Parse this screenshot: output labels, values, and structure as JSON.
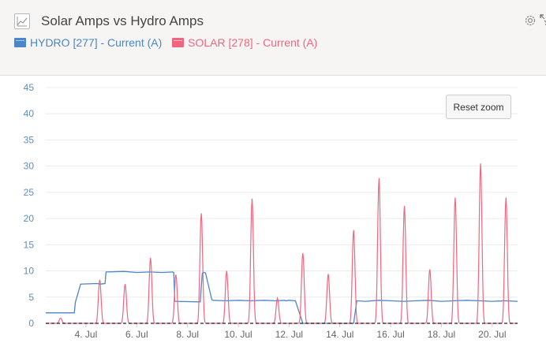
{
  "header": {
    "title": "Solar Amps vs Hydro Amps",
    "icon": "line-chart-icon",
    "settings_icon": "gear-icon",
    "fullscreen_icon": "expand-icon"
  },
  "reset_zoom_label": "Reset zoom",
  "colors": {
    "hydro": "#4a86c8",
    "solar": "#f0667e",
    "threshold": "#222222",
    "header_bg": "#f7f5f3"
  },
  "chart_data": {
    "type": "line",
    "ylim": [
      0,
      45
    ],
    "yticks": [
      0,
      5,
      10,
      15,
      20,
      25,
      30,
      35,
      40,
      45
    ],
    "xlim": [
      "2018-07-02T10:00",
      "2018-07-21T00:00"
    ],
    "xticks": [
      "4. Jul",
      "6. Jul",
      "8. Jul",
      "10. Jul",
      "12. Jul",
      "14. Jul",
      "16. Jul",
      "18. Jul",
      "20. Jul"
    ],
    "xtick_dates": [
      "2018-07-04",
      "2018-07-06",
      "2018-07-08",
      "2018-07-10",
      "2018-07-12",
      "2018-07-14",
      "2018-07-16",
      "2018-07-18",
      "2018-07-20"
    ],
    "grid": "horizontal",
    "legend": "top-left",
    "threshold_line": 0,
    "series": [
      {
        "name": "HYDRO [277] - Current (A)",
        "color": "#4a86c8",
        "x": [
          "2018-07-02T10:00",
          "2018-07-03T12:00",
          "2018-07-03T13:00",
          "2018-07-03T14:00",
          "2018-07-03T19:00",
          "2018-07-04T10:00",
          "2018-07-04T14:00",
          "2018-07-04T18:00",
          "2018-07-04T19:00",
          "2018-07-05T12:00",
          "2018-07-06T00:00",
          "2018-07-06T12:00",
          "2018-07-07T00:00",
          "2018-07-07T10:00",
          "2018-07-07T11:00",
          "2018-07-07T12:00",
          "2018-07-08T12:00",
          "2018-07-08T14:00",
          "2018-07-08T16:00",
          "2018-07-08T17:00",
          "2018-07-08T23:00",
          "2018-07-09T00:00",
          "2018-07-09T12:00",
          "2018-07-10T00:00",
          "2018-07-10T12:00",
          "2018-07-11T00:00",
          "2018-07-11T12:00",
          "2018-07-11T20:00",
          "2018-07-11T21:00",
          "2018-07-12T00:00",
          "2018-07-12T06:00",
          "2018-07-12T13:00",
          "2018-07-14T13:00",
          "2018-07-14T16:00",
          "2018-07-15T00:00",
          "2018-07-15T12:00",
          "2018-07-16T00:00",
          "2018-07-16T12:00",
          "2018-07-17T00:00",
          "2018-07-17T12:00",
          "2018-07-18T00:00",
          "2018-07-18T12:00",
          "2018-07-19T00:00",
          "2018-07-19T12:00",
          "2018-07-20T00:00",
          "2018-07-20T12:00",
          "2018-07-21T00:00"
        ],
        "values": [
          2,
          2,
          2,
          4,
          7.5,
          7.6,
          7.5,
          7.6,
          9.8,
          9.9,
          9.7,
          9.8,
          9.7,
          9.8,
          9.7,
          4.2,
          4.1,
          9.6,
          9.7,
          9.6,
          4.5,
          4.4,
          4.3,
          4.4,
          4.3,
          4.4,
          4.3,
          4.4,
          4.3,
          4.4,
          4.3,
          0,
          0,
          4.3,
          4.2,
          4.4,
          4.3,
          4.2,
          4.3,
          4.4,
          4.2,
          4.3,
          4.4,
          4.3,
          4.2,
          4.3,
          4.2
        ]
      },
      {
        "name": "SOLAR [278] - Current (A)",
        "color": "#f0667e",
        "peaks": [
          {
            "time": "2018-07-03T00:00",
            "value": 1.0
          },
          {
            "time": "2018-07-04T13:00",
            "value": 8.3
          },
          {
            "time": "2018-07-05T13:00",
            "value": 7.5
          },
          {
            "time": "2018-07-06T13:00",
            "value": 12.5
          },
          {
            "time": "2018-07-07T13:00",
            "value": 9.3
          },
          {
            "time": "2018-07-08T13:00",
            "value": 21.0
          },
          {
            "time": "2018-07-09T13:00",
            "value": 10.0
          },
          {
            "time": "2018-07-10T13:00",
            "value": 23.8
          },
          {
            "time": "2018-07-11T13:00",
            "value": 4.8
          },
          {
            "time": "2018-07-12T13:00",
            "value": 13.4
          },
          {
            "time": "2018-07-13T13:00",
            "value": 9.4
          },
          {
            "time": "2018-07-14T13:00",
            "value": 17.8
          },
          {
            "time": "2018-07-15T13:00",
            "value": 27.7
          },
          {
            "time": "2018-07-16T13:00",
            "value": 22.4
          },
          {
            "time": "2018-07-17T13:00",
            "value": 10.3
          },
          {
            "time": "2018-07-18T13:00",
            "value": 24.0
          },
          {
            "time": "2018-07-19T13:00",
            "value": 30.5
          },
          {
            "time": "2018-07-20T13:00",
            "value": 24.0
          }
        ],
        "daylight_start_hour": 8,
        "daylight_end_hour": 18
      }
    ]
  }
}
